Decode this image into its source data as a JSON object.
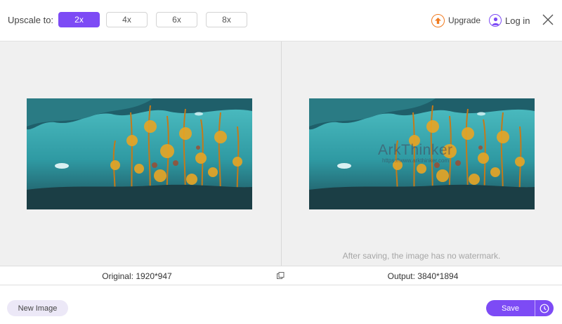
{
  "toolbar": {
    "upscale_label": "Upscale to:",
    "scales": [
      {
        "label": "2x",
        "selected": true
      },
      {
        "label": "4x",
        "selected": false
      },
      {
        "label": "6x",
        "selected": false
      },
      {
        "label": "8x",
        "selected": false
      }
    ],
    "upgrade_label": "Upgrade",
    "upgrade_icon": "upgrade-arrow-icon",
    "login_label": "Log in",
    "login_icon": "user-icon",
    "close_icon": "close-icon"
  },
  "preview": {
    "watermark_text": "ArkThinker",
    "watermark_url": "https://www.arkthinker.com",
    "notice": "After saving, the image has no watermark."
  },
  "info": {
    "original": "Original: 1920*947",
    "output": "Output: 3840*1894",
    "compare_icon": "compare-icon"
  },
  "footer": {
    "new_image_label": "New Image",
    "save_label": "Save",
    "history_icon": "clock-icon"
  },
  "colors": {
    "accent": "#7d4bf5",
    "upgrade": "#f07a1f",
    "preview_bg": "#f0f0f0"
  }
}
